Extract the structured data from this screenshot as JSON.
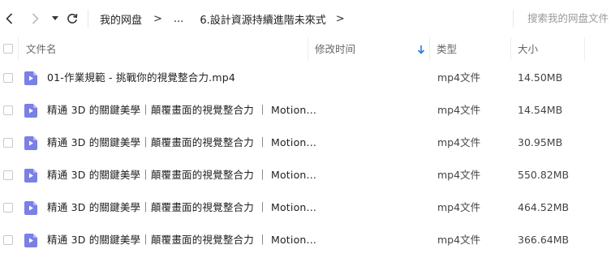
{
  "toolbar": {
    "back_icon": "chevron-left-icon",
    "forward_icon": "chevron-right-icon",
    "dropdown_icon": "caret-down-icon",
    "refresh_icon": "refresh-icon"
  },
  "breadcrumb": {
    "root": "我的网盘",
    "separator": ">",
    "ellipsis": "...",
    "current": "6.設計資源持續進階未來式",
    "trailing_separator": ">"
  },
  "search": {
    "placeholder": "搜索我的网盘文件"
  },
  "columns": {
    "name": "文件名",
    "modified": "修改时间",
    "type": "类型",
    "size": "大小",
    "sort_icon": "sort-down-arrow-icon"
  },
  "files": [
    {
      "name": "01-作業規範 - 挑戰你的視覺整合力.mp4",
      "type": "mp4文件",
      "size": "14.50MB"
    },
    {
      "name": "精通 3D 的關鍵美學｜顛覆畫面的視覺整合力 ｜ Motion...",
      "type": "mp4文件",
      "size": "14.54MB"
    },
    {
      "name": "精通 3D 的關鍵美學｜顛覆畫面的視覺整合力 ｜ Motion...",
      "type": "mp4文件",
      "size": "30.95MB"
    },
    {
      "name": "精通 3D 的關鍵美學｜顛覆畫面的視覺整合力 ｜ Motion...",
      "type": "mp4文件",
      "size": "550.82MB"
    },
    {
      "name": "精通 3D 的關鍵美學｜顛覆畫面的視覺整合力 ｜ Motion...",
      "type": "mp4文件",
      "size": "464.52MB"
    },
    {
      "name": "精通 3D 的關鍵美學｜顛覆畫面的視覺整合力 ｜ Motion...",
      "type": "mp4文件",
      "size": "366.64MB"
    }
  ],
  "colors": {
    "accent": "#1a7ce8",
    "file_icon": "#7b80e6",
    "file_icon_fold": "#b7baf2"
  },
  "file_icon": "video-file-icon"
}
